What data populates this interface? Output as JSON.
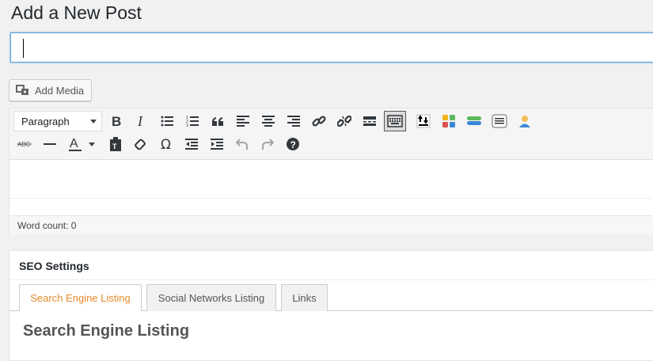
{
  "page": {
    "title": "Add a New Post"
  },
  "post_title": {
    "value": "",
    "placeholder": ""
  },
  "media": {
    "add_media_label": "Add Media"
  },
  "editor": {
    "format_select": "Paragraph",
    "word_count_label": "Word count: 0",
    "toolbar_row1": [
      "bold-icon",
      "italic-icon",
      "bullet-list-icon",
      "numbered-list-icon",
      "blockquote-icon",
      "align-left-icon",
      "align-center-icon",
      "align-right-icon",
      "link-icon",
      "unlink-icon",
      "read-more-icon",
      "toolbar-toggle-icon",
      "upload-icon",
      "grid-plugin-icon",
      "stack-plugin-icon",
      "table-plugin-icon",
      "user-plugin-icon"
    ],
    "toolbar_row2": [
      "strikethrough-icon",
      "horizontal-line-icon",
      "text-color-icon",
      "paste-text-icon",
      "clear-formatting-icon",
      "special-character-icon",
      "outdent-icon",
      "indent-icon",
      "undo-icon",
      "redo-icon",
      "help-icon"
    ]
  },
  "seo": {
    "box_title": "SEO Settings",
    "tabs": [
      {
        "label": "Search Engine Listing",
        "active": true
      },
      {
        "label": "Social Networks Listing",
        "active": false
      },
      {
        "label": "Links",
        "active": false
      }
    ],
    "section_title": "Search Engine Listing"
  },
  "colors": {
    "accent": "#e6892c",
    "focus_border": "#5b9dd9"
  }
}
